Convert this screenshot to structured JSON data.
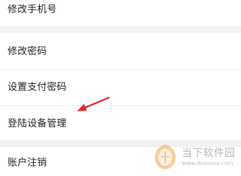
{
  "settings_list": {
    "items": [
      {
        "label": "修改手机号"
      },
      {
        "label": "修改密码"
      },
      {
        "label": "设置支付密码"
      },
      {
        "label": "登陆设备管理"
      },
      {
        "label": "账户注销"
      }
    ]
  },
  "annotation": {
    "arrow_color": "#e0262b"
  },
  "watermark": {
    "title": "当下软件园",
    "url": "www.downxia.com"
  },
  "colors": {
    "background": "#f2f2f2",
    "row_background": "#ffffff",
    "text": "#1f1f1f",
    "arrow": "#e0262b",
    "watermark_orange": "#f0a54a",
    "watermark_gray": "#b7b7b7"
  }
}
